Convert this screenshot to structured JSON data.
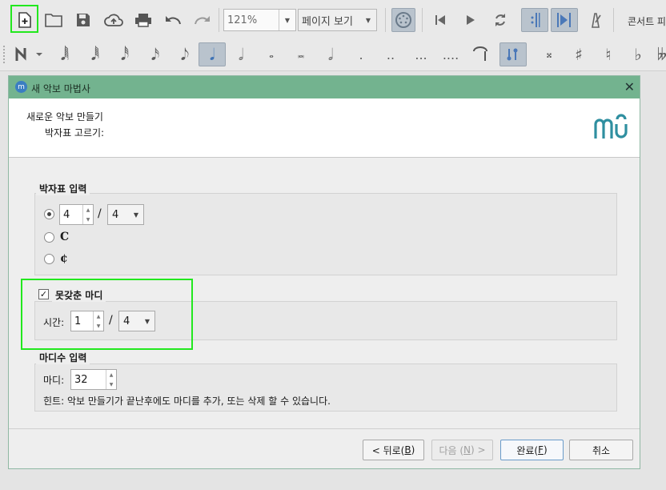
{
  "toolbar": {
    "zoom_value": "121%",
    "view_mode": "페이지 보기",
    "concert_pitch": "콘서트 피"
  },
  "note_toolbar": {
    "dot_single": ".",
    "dot_double": "..",
    "dot_triple": "...",
    "dot_quad": "...."
  },
  "dialog": {
    "title": "새 악보 마법사",
    "header_title": "새로운 악보 만들기",
    "header_subtitle": "박자표 고르기:",
    "time_sig_group": {
      "label": "박자표 입력",
      "numerator": "4",
      "slash": "/",
      "denominator": "4",
      "common_time_symbol": "C",
      "cut_time_symbol": "¢",
      "selected": "numeric"
    },
    "pickup_group": {
      "label": "못갖춘 마디",
      "checked": true,
      "check_mark": "✓",
      "time_label": "시간:",
      "numerator": "1",
      "slash": "/",
      "denominator": "4"
    },
    "measures_group": {
      "label": "마디수 입력",
      "measures_label": "마디:",
      "measures_value": "32",
      "hint": "힌트: 악보 만들기가 끝난후에도 마디를 추가, 또는 삭제 할 수 있습니다."
    },
    "buttons": {
      "back_prefix": "< 뒤로(",
      "back_key": "B",
      "back_suffix": ")",
      "next_prefix": "다음 (",
      "next_key": "N",
      "next_suffix": ") >",
      "finish_prefix": "완료(",
      "finish_key": "F",
      "finish_suffix": ")",
      "cancel": "취소"
    }
  },
  "colors": {
    "highlight": "#22e81e",
    "dialog_title_bar": "#73b38f",
    "logo": "#2f8fa0"
  }
}
